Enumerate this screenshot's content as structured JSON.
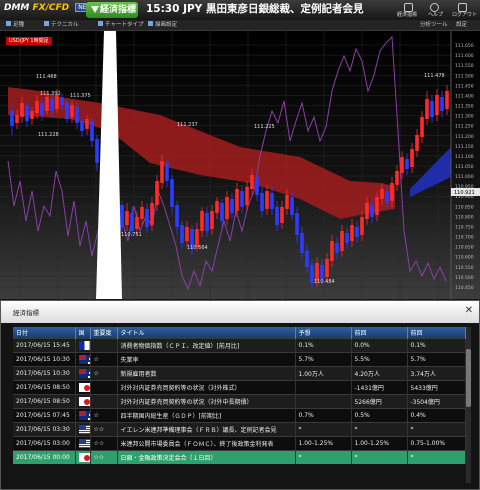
{
  "topbar": {
    "logo": "DMM",
    "logo_fx": "FX/CFD",
    "logo_badge": "NEO",
    "news_tab_label": "経済指標",
    "news_ticker": "15:30 JPY 黒田東彦日銀総裁、定例記者会見",
    "right_buttons": [
      {
        "label": "経済指標",
        "icon": "calendar-icon"
      },
      {
        "label": "ヘルプ",
        "icon": "help-icon"
      },
      {
        "label": "ログアウト",
        "icon": "logout-icon"
      }
    ]
  },
  "toolbar": {
    "items": [
      "足種",
      "テクニカル",
      "チャートタイプ",
      "描画設定"
    ],
    "right_items": [
      "分析ツール",
      "設定"
    ]
  },
  "chart": {
    "pair_label": "USD/JPY 1時間足",
    "price_labels": [
      "111.468",
      "111.392",
      "111.375",
      "111.228",
      "111.237",
      "111.225",
      "111.478",
      "110.751",
      "110.664",
      "110.484"
    ],
    "y_axis_ticks": [
      "111.650",
      "111.600",
      "111.550",
      "111.500",
      "111.450",
      "111.400",
      "111.350",
      "111.300",
      "111.250",
      "111.200",
      "111.150",
      "111.100",
      "111.050",
      "111.000",
      "110.950",
      "110.900",
      "110.850",
      "110.800",
      "110.750",
      "110.700",
      "110.650",
      "110.600",
      "110.550",
      "110.500",
      "110.450"
    ],
    "current_price": "110.921",
    "colors": {
      "up": "#ff2a2a",
      "down": "#2c3cff",
      "cloud_bear": "#a51d1d",
      "cloud_bull": "#1f2ea8",
      "lagging": "#8a3fa8"
    }
  },
  "dialog": {
    "title": "経済指標",
    "columns": [
      "日付",
      "国",
      "重要度",
      "タイトル",
      "予想",
      "前回",
      "前回"
    ],
    "rows": [
      {
        "date": "2017/06/15 15:45",
        "flag": "fr",
        "importance": "",
        "title": "消費者物価指数（ＣＰＩ、改定値）[前月比]",
        "forecast": "0.1%",
        "actual": "0.0%",
        "previous": "0.1%"
      },
      {
        "date": "2017/06/15 10:30",
        "flag": "au",
        "importance": "☆",
        "title": "失業率",
        "forecast": "5.7%",
        "actual": "5.5%",
        "previous": "5.7%"
      },
      {
        "date": "2017/06/15 10:30",
        "flag": "au",
        "importance": "☆",
        "title": "新規雇用者数",
        "forecast": "1.00万人",
        "actual": "4.20万人",
        "previous": "3.74万人"
      },
      {
        "date": "2017/06/15 08:50",
        "flag": "jp",
        "importance": "",
        "title": "対外対内証券売買契約等の状況（対外株式）",
        "forecast": "",
        "actual": "-1431億円",
        "previous": "5433億円"
      },
      {
        "date": "2017/06/15 08:50",
        "flag": "jp",
        "importance": "",
        "title": "対外対内証券売買契約等の状況（対外中長期債）",
        "forecast": "",
        "actual": "5266億円",
        "previous": "-3504億円"
      },
      {
        "date": "2017/06/15 07:45",
        "flag": "au",
        "importance": "☆",
        "title": "四半期国内総生産（ＧＤＰ）[前期比]",
        "forecast": "0.7%",
        "actual": "0.5%",
        "previous": "0.4%"
      },
      {
        "date": "2017/06/15 03:30",
        "flag": "us",
        "importance": "☆☆",
        "title": "イエレン米連邦準備理事会（ＦＲＢ）議長、定例記者会見",
        "forecast": "*",
        "actual": "*",
        "previous": "*"
      },
      {
        "date": "2017/06/15 03:00",
        "flag": "us",
        "importance": "☆☆",
        "title": "米連邦公開市場委員会（ＦＯＭＣ）、終了後政策金利発表",
        "forecast": "1.00-1.25%",
        "actual": "1.00-1.25%",
        "previous": "0.75-1.00%"
      },
      {
        "date": "2017/06/15 00:00",
        "flag": "jp",
        "importance": "☆☆",
        "title": "日銀・金融政策決定会合（１日目）",
        "forecast": "*",
        "actual": "*",
        "previous": "*"
      }
    ]
  }
}
